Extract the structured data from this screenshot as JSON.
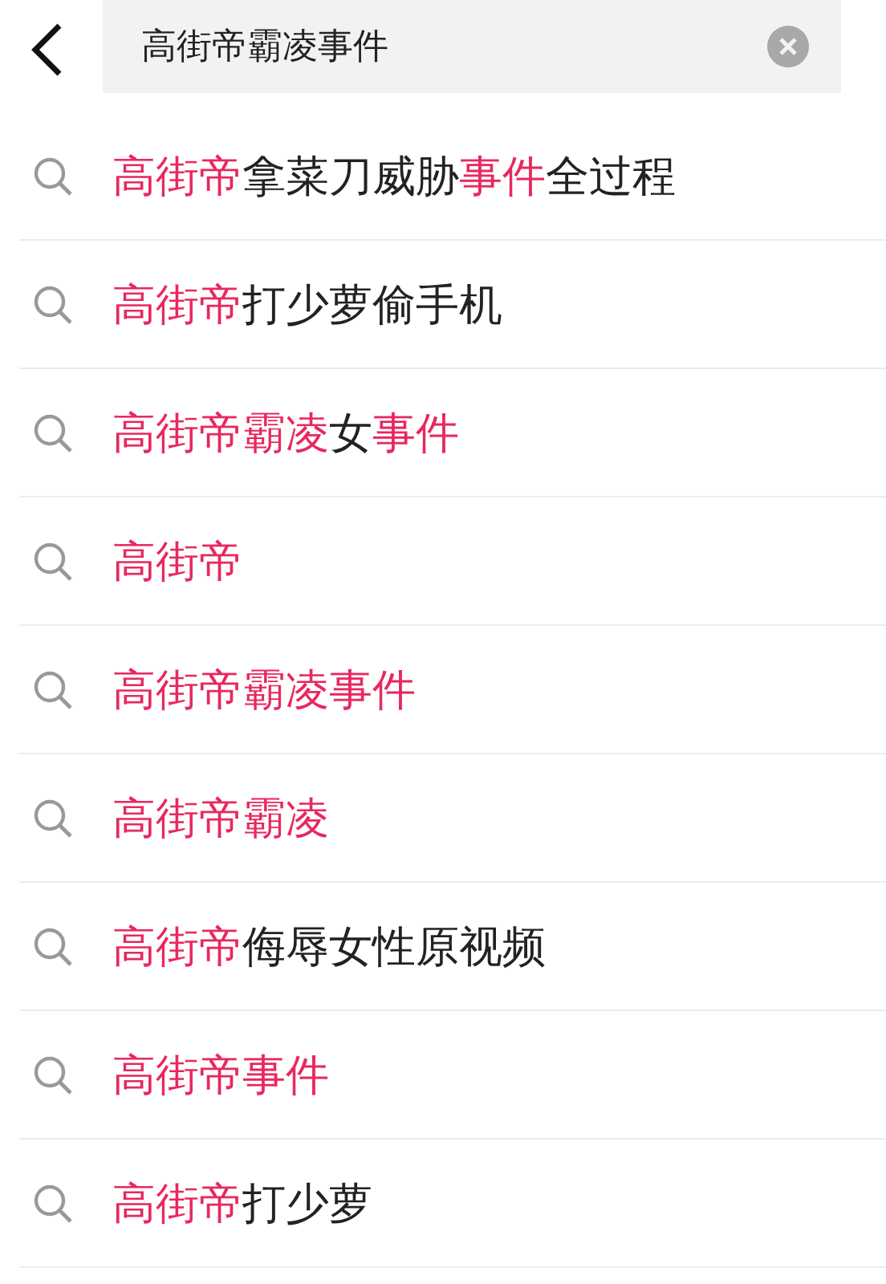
{
  "search": {
    "value": "高街帝霸凌事件"
  },
  "suggestions": [
    {
      "parts": [
        {
          "text": "高街帝",
          "highlighted": true
        },
        {
          "text": "拿菜刀威胁",
          "highlighted": false
        },
        {
          "text": "事件",
          "highlighted": true
        },
        {
          "text": "全过程",
          "highlighted": false
        }
      ]
    },
    {
      "parts": [
        {
          "text": "高街帝",
          "highlighted": true
        },
        {
          "text": "打少萝偷手机",
          "highlighted": false
        }
      ]
    },
    {
      "parts": [
        {
          "text": "高街帝霸凌",
          "highlighted": true
        },
        {
          "text": "女",
          "highlighted": false
        },
        {
          "text": "事件",
          "highlighted": true
        }
      ]
    },
    {
      "parts": [
        {
          "text": "高街帝",
          "highlighted": true
        }
      ]
    },
    {
      "parts": [
        {
          "text": "高街帝霸凌事件",
          "highlighted": true
        }
      ]
    },
    {
      "parts": [
        {
          "text": "高街帝霸凌",
          "highlighted": true
        }
      ]
    },
    {
      "parts": [
        {
          "text": "高街帝",
          "highlighted": true
        },
        {
          "text": "侮辱女性原视频",
          "highlighted": false
        }
      ]
    },
    {
      "parts": [
        {
          "text": "高街帝事件",
          "highlighted": true
        }
      ]
    },
    {
      "parts": [
        {
          "text": "高街帝",
          "highlighted": true
        },
        {
          "text": "打少萝",
          "highlighted": false
        }
      ]
    }
  ]
}
